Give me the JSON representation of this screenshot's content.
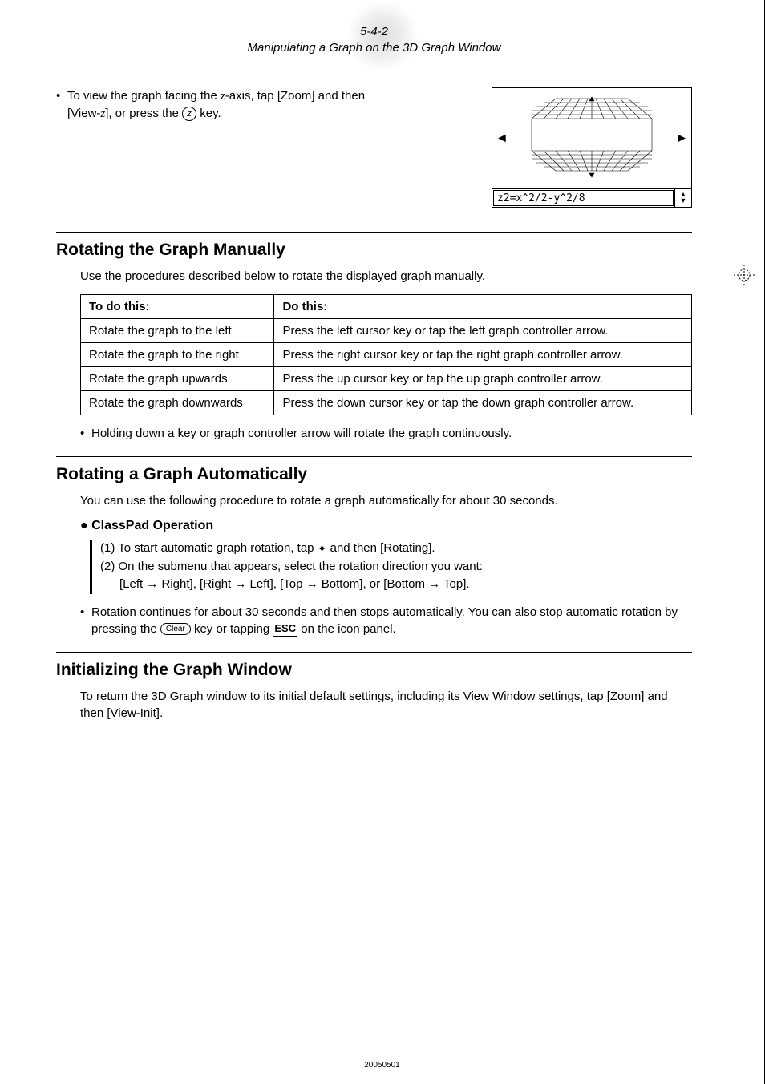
{
  "header": {
    "page_ref": "5-4-2",
    "title": "Manipulating a Graph on the 3D Graph Window"
  },
  "intro": {
    "line1_pre": "To view the graph facing the ",
    "z_axis": "z",
    "line1_mid": "-axis, tap [Zoom] and then",
    "line2_pre": "[View-",
    "line2_z": "z",
    "line2_mid": "], or press the ",
    "line2_end": " key."
  },
  "screenshot": {
    "formula": "z2=x^2/2-y^2/8"
  },
  "section1": {
    "heading": "Rotating the Graph Manually",
    "intro": "Use the procedures described below to rotate the displayed graph manually.",
    "th1": "To do this:",
    "th2": "Do this:",
    "rows": [
      {
        "a": "Rotate the graph to the left",
        "b": "Press the left cursor key or tap the left graph controller arrow."
      },
      {
        "a": "Rotate the graph to the right",
        "b": "Press the right cursor key or tap the right graph controller arrow."
      },
      {
        "a": "Rotate the graph upwards",
        "b": "Press the up cursor key or tap the up graph controller arrow."
      },
      {
        "a": "Rotate the graph downwards",
        "b": "Press the down cursor key or tap the down graph controller arrow."
      }
    ],
    "note": "Holding down a key or graph controller arrow will rotate the graph continuously."
  },
  "section2": {
    "heading": "Rotating a Graph Automatically",
    "intro": "You can use the following procedure to rotate a graph automatically for about 30 seconds.",
    "op_heading": "ClassPad Operation",
    "step1_pre": "(1) To start automatic graph rotation, tap ",
    "step1_post": " and then [Rotating].",
    "step2_l1": "(2) On the submenu that appears, select the rotation direction you want:",
    "step2_l2": "[Left → Right], [Right → Left], [Top → Bottom], or [Bottom → Top].",
    "note_pre": "Rotation continues for about 30 seconds and then stops automatically. You can also stop automatic rotation by pressing the ",
    "clear_label": "Clear",
    "note_mid": " key or tapping ",
    "esc_label": "ESC",
    "note_post": " on the icon panel."
  },
  "section3": {
    "heading": "Initializing the Graph Window",
    "body": "To return the 3D Graph window to its initial default settings, including its View Window settings, tap [Zoom] and then [View-Init]."
  },
  "footer": "20050501"
}
